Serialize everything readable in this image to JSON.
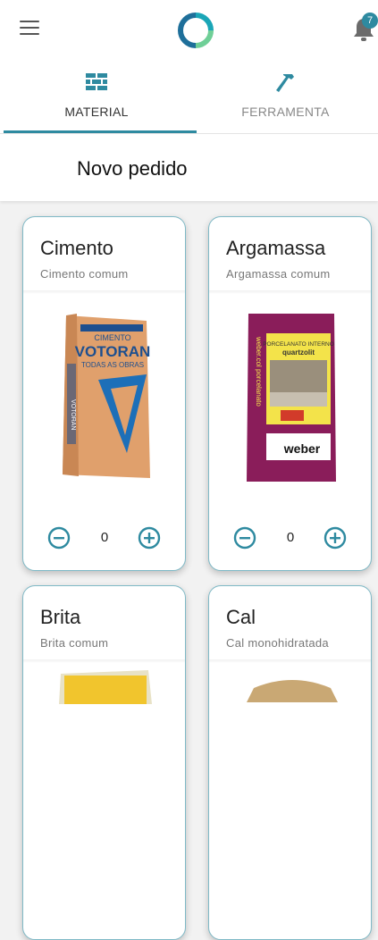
{
  "header": {
    "notification_count": "7",
    "menu_icon": "hamburger-menu-icon",
    "bell_icon": "bell-icon",
    "accent_color": "#2e8aa0"
  },
  "tabs": [
    {
      "label": "MATERIAL",
      "icon": "brick-wall-icon",
      "active": true
    },
    {
      "label": "FERRAMENTA",
      "icon": "hammer-icon",
      "active": false
    }
  ],
  "page": {
    "title": "Novo pedido"
  },
  "products": [
    {
      "name": "Cimento",
      "description": "Cimento comum",
      "quantity": "0"
    },
    {
      "name": "Argamassa",
      "description": "Argamassa comum",
      "quantity": "0"
    },
    {
      "name": "Brita",
      "description": "Brita comum"
    },
    {
      "name": "Cal",
      "description": "Cal monohidratada"
    }
  ],
  "product_art": {
    "cimento_bag": {
      "line1": "CIMENTO",
      "brand": "VOTORAN",
      "line2": "TODAS AS OBRAS",
      "side": "VOTORAN"
    },
    "argamassa_bag": {
      "line1": "PORCELANATO INTERNO",
      "line2": "quartzolit",
      "brand": "weber",
      "side": "weber.col porcelanato"
    }
  }
}
